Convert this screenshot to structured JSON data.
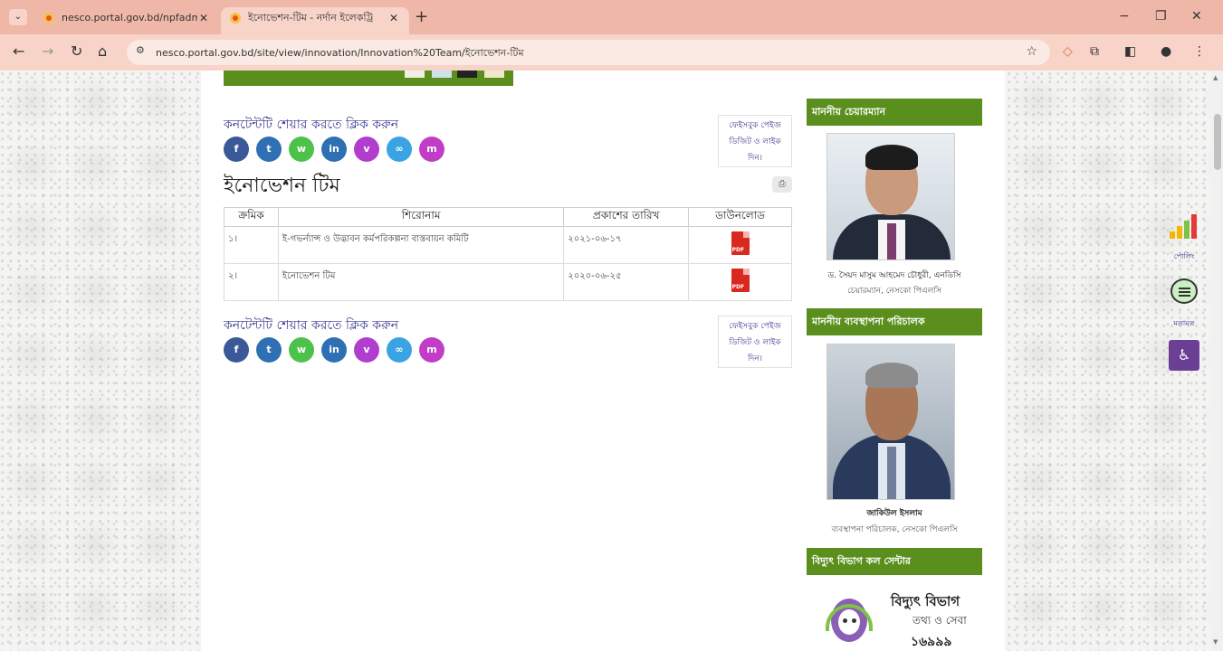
{
  "browser": {
    "tabs": [
      {
        "title": "nesco.portal.gov.bd/npfadmin/",
        "active": false
      },
      {
        "title": "ইনোভেশন-টিম - নর্দান ইলেকট্রি",
        "active": true
      }
    ],
    "new_tab_symbol": "+",
    "url": "nesco.portal.gov.bd/site/view/innovation/Innovation%20Team/ইনোভেশন-টিম",
    "window_controls": {
      "minimize": "−",
      "restore": "❐",
      "close": "✕"
    }
  },
  "share": {
    "label": "কনটেন্টটি শেয়ার করতে ক্লিক করুন",
    "buttons": [
      {
        "name": "facebook",
        "glyph": "f",
        "color": "#3b5998"
      },
      {
        "name": "twitter",
        "glyph": "t",
        "color": "#2f6fb3"
      },
      {
        "name": "whatsapp",
        "glyph": "w",
        "color": "#4cc24b"
      },
      {
        "name": "linkedin",
        "glyph": "in",
        "color": "#2f6fb3"
      },
      {
        "name": "viber",
        "glyph": "v",
        "color": "#b13dcf"
      },
      {
        "name": "link",
        "glyph": "∞",
        "color": "#3aa3e3"
      },
      {
        "name": "messenger",
        "glyph": "m",
        "color": "#c13dc8"
      }
    ]
  },
  "fb_box": {
    "line1": "ফেইসবুক পেইজ",
    "line2": "ডিজিট ও লাইক",
    "line3": "দিন।"
  },
  "page": {
    "title": "ইনোভেশন টিম",
    "table": {
      "headers": [
        "ক্রমিক",
        "শিরোনাম",
        "প্রকাশের তারিখ",
        "ডাউনলোড"
      ],
      "rows": [
        {
          "serial": "১।",
          "title": "ই-গভর্ন্যান্স ও উদ্ভাবন কর্মপরিকল্পনা বাস্তবায়ন কমিটি",
          "date": "২০২১-০৬-১৭",
          "file": "PDF"
        },
        {
          "serial": "২।",
          "title": "ইনোভেশন টিম",
          "date": "২০২০-০৬-২৫",
          "file": "PDF"
        }
      ]
    }
  },
  "sidebar": {
    "chairman": {
      "heading": "মাননীয় চেয়ারম্যান",
      "name": "ড. সৈয়দ মাসুম আহমেদ চৌধুরী, এনডিসি",
      "role": "চেয়ারম্যান, নেসকো পিএলসি"
    },
    "md": {
      "heading": "মাননীয় ব্যবস্থাপনা পরিচালক",
      "name": "জাকিউল ইসলাম",
      "role": "ব্যবস্থাপনা পরিচালক, নেসকো পিএলসি"
    },
    "callcenter": {
      "heading": "বিদ্যুৎ বিভাগ কল সেন্টার",
      "title": "বিদ্যুৎ বিভাগ",
      "subtitle": "তথ্য ও সেবা",
      "number": "১৬৯৯৯"
    }
  },
  "floating": {
    "poll_label": "পোলিং",
    "feedback_label": "মতামত",
    "accessibility_glyph": "♿"
  },
  "colors": {
    "brand_green": "#5a8f1d",
    "link_purple": "#3b3b8f",
    "pdf_red": "#d9281f",
    "tab_bar": "#efb7a7"
  }
}
